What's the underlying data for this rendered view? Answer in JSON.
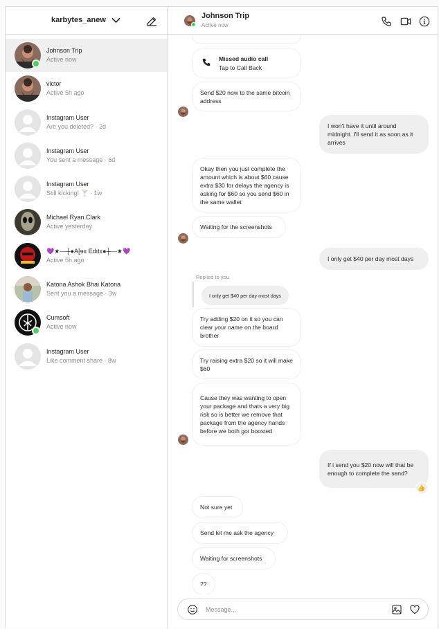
{
  "sidebar": {
    "account_name": "karbytes_anew",
    "threads": [
      {
        "name": "Johnson Trip",
        "sub": "Active now",
        "online": true,
        "active": true,
        "avatar": "bearded-man"
      },
      {
        "name": "victor",
        "sub": "Active 5h ago",
        "online": false,
        "active": false,
        "avatar": "bearded-man"
      },
      {
        "name": "Instagram User",
        "sub": "Are you deleted? · 2d",
        "online": false,
        "active": false,
        "avatar": "default"
      },
      {
        "name": "Instagram User",
        "sub": "You sent a message · 6d",
        "online": false,
        "active": false,
        "avatar": "default"
      },
      {
        "name": "Instagram User",
        "sub": "Still kicking! 🍸 · 1w",
        "online": false,
        "active": false,
        "avatar": "default"
      },
      {
        "name": "Michael Ryan Clark",
        "sub": "Active yesterday",
        "online": false,
        "active": false,
        "avatar": "alien"
      },
      {
        "name": "💜★—┼●A[ɘx Edıtx●┼—★💜",
        "sub": "Active 5h ago",
        "online": false,
        "active": false,
        "avatar": "red-mask"
      },
      {
        "name": "Katona Ashok Bhai Katona",
        "sub": "Sent you a message · 3w",
        "online": false,
        "active": false,
        "avatar": "photo-person"
      },
      {
        "name": "Cumsoft",
        "sub": "Active now",
        "online": true,
        "active": false,
        "avatar": "white-logo"
      },
      {
        "name": "Instagram User",
        "sub": "Like comment share · 8w",
        "online": false,
        "active": false,
        "avatar": "default"
      }
    ]
  },
  "chat": {
    "name": "Johnson Trip",
    "status": "Active now",
    "icons": [
      "phone-icon",
      "video-icon",
      "info-icon"
    ],
    "missed_call": {
      "title": "Missed audio call",
      "sub": "Tap to Call Back"
    },
    "messages": [
      {
        "from": "them",
        "text": "Send $20 now to the same bitcoin address"
      },
      {
        "from": "me",
        "text": "I won't have it until around midnight. I'll send it as soon as it arrives"
      },
      {
        "from": "them",
        "text": "Okay then you just complete the amount which is about $60 cause extra $30 for delays the agency is asking for $60 so you send $60 in the same wallet"
      },
      {
        "from": "them",
        "text": "Waiting for the screenshots"
      },
      {
        "from": "me",
        "text": "I only get $40 per day most days"
      },
      {
        "from": "them",
        "text": "Try adding $20 on it so you can clear your name on the board brother"
      },
      {
        "from": "them",
        "text": "Try raising extra $20 so it will make $60"
      },
      {
        "from": "them",
        "text": "Cause they was wanting to open your package and thats a very big risk so is better we remove that package from the agency hands before we both got boosted"
      },
      {
        "from": "me",
        "text": "If i send you $20 now will that be enough to complete the send?"
      },
      {
        "from": "them",
        "text": "Not sure yet"
      },
      {
        "from": "them",
        "text": "Send let me ask the agency"
      },
      {
        "from": "them",
        "text": "Waiting for screenshots"
      },
      {
        "from": "them",
        "text": "??"
      }
    ],
    "reply": {
      "label": "Replied to you",
      "quoted": "I only get $40 per day most days"
    },
    "reaction": "👍",
    "composer_placeholder": "Message..."
  },
  "colors": {
    "online": "#4bd160",
    "border": "#dbdbdb",
    "bubble_out": "#efefef",
    "muted": "#8e8e8e"
  }
}
